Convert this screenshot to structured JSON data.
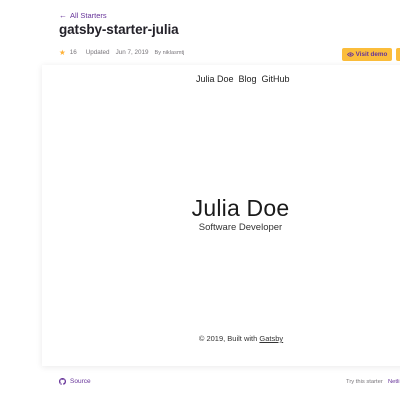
{
  "header": {
    "back_label": "All Starters",
    "back_icon": "arrow-left-icon",
    "title": "gatsby-starter-julia",
    "stars": "16",
    "star_icon": "star-icon",
    "updated": "Updated",
    "updated_date": "Jun 7, 2019",
    "author": "By niklasmtj",
    "demo_button": "Visit demo",
    "demo_icon": "eye-icon"
  },
  "preview": {
    "nav": [
      "Julia Doe",
      "Blog",
      "GitHub"
    ],
    "hero_name": "Julia Doe",
    "hero_role": "Software Developer",
    "footer_prefix": "© 2019, Built with",
    "footer_link": "Gatsby"
  },
  "footer": {
    "source_label": "Source",
    "source_icon": "github-icon",
    "try_label": "Try this starter",
    "netlify_label": "Netli"
  },
  "colors": {
    "accent": "#663399",
    "button": "#fbbd3b",
    "star": "#ffb238"
  }
}
